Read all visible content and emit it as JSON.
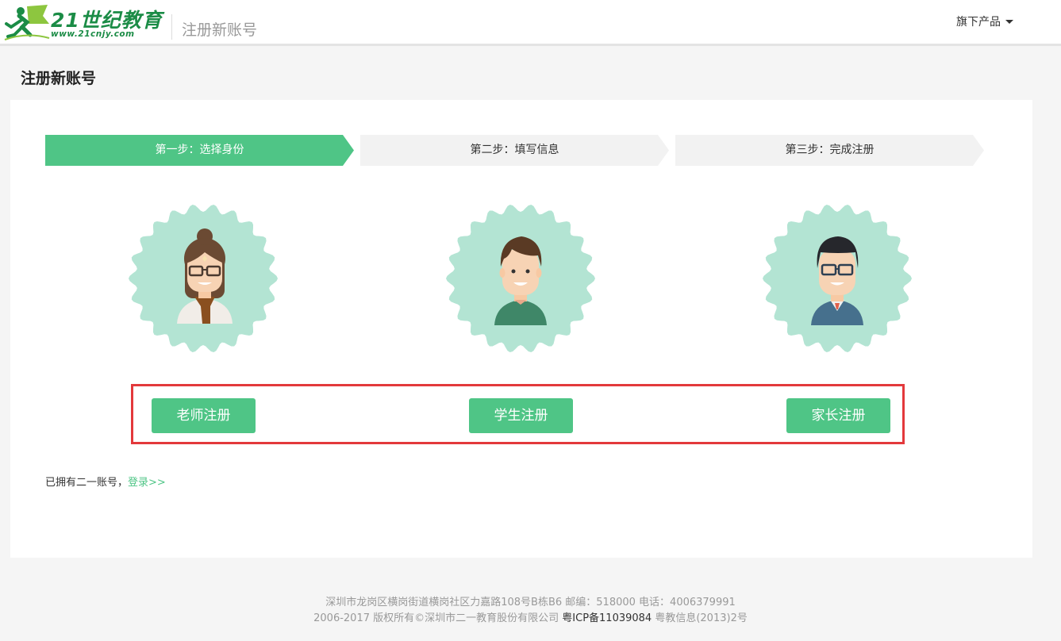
{
  "header": {
    "logo_main": "21世纪教育",
    "logo_sub": "www.21cnjy.com",
    "title": "注册新账号",
    "products_menu": "旗下产品"
  },
  "page": {
    "heading": "注册新账号"
  },
  "steps": [
    {
      "label": "第一步：选择身份",
      "active": true
    },
    {
      "label": "第二步：填写信息",
      "active": false
    },
    {
      "label": "第三步：完成注册",
      "active": false
    }
  ],
  "roles": [
    {
      "icon": "teacher-avatar-icon",
      "button_label": "老师注册"
    },
    {
      "icon": "student-avatar-icon",
      "button_label": "学生注册"
    },
    {
      "icon": "parent-avatar-icon",
      "button_label": "家长注册"
    }
  ],
  "login_prompt": {
    "text": "已拥有二一账号，",
    "link_text": "登录>>"
  },
  "footer": {
    "address_line": "深圳市龙岗区横岗街道横岗社区力嘉路108号B栋B6 邮编：518000 电话：4006379991",
    "copyright": "2006-2017 版权所有©深圳市二一教育股份有限公司",
    "icp": "粤ICP备11039084",
    "license": "粤教信息(2013)2号"
  },
  "colors": {
    "accent_green": "#4fc586",
    "logo_green": "#1b8c46",
    "highlight_red": "#e3393c",
    "badge_mint": "#b3e4d3",
    "step_inactive": "#f2f2f2"
  }
}
